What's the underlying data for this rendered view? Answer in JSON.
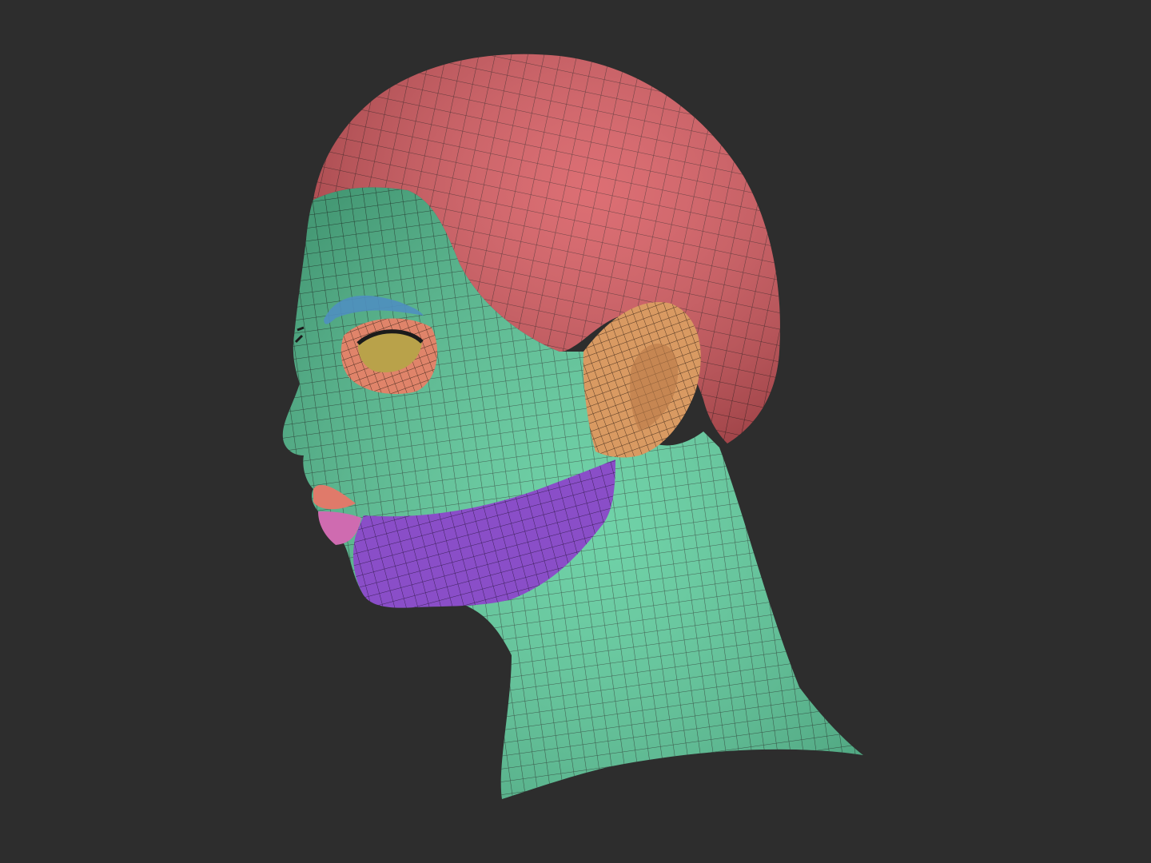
{
  "scene": {
    "background_color": "#2d2d2d",
    "subject": "head-mesh",
    "polygroups": [
      {
        "id": "skin",
        "color": "#5ccc9c"
      },
      {
        "id": "hair-cap",
        "color": "#d6555b"
      },
      {
        "id": "ear",
        "color": "#d99a62"
      },
      {
        "id": "jaw",
        "color": "#8a4ec8"
      },
      {
        "id": "lower-lip",
        "color": "#cf6bb0"
      },
      {
        "id": "upper-lip",
        "color": "#e07a6a"
      },
      {
        "id": "eye-socket",
        "color": "#e0846a"
      },
      {
        "id": "eyeball",
        "color": "#b9a24a"
      },
      {
        "id": "eyebrow",
        "color": "#4f8fc0"
      },
      {
        "id": "wire",
        "color": "#1f2a24"
      }
    ]
  }
}
